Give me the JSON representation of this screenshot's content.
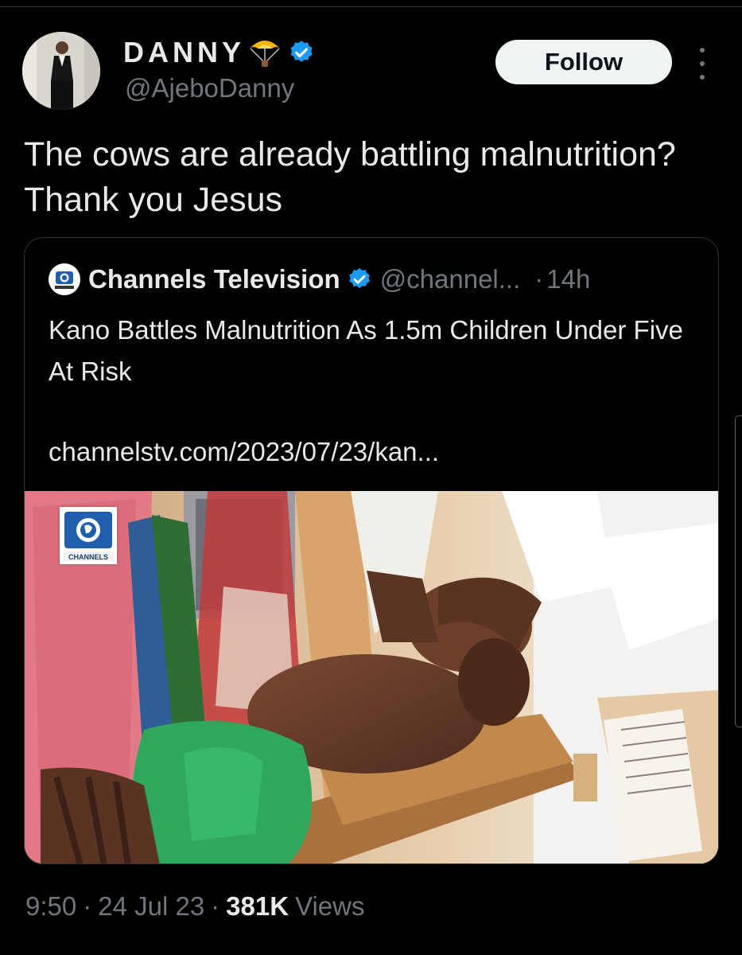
{
  "tweet": {
    "author_name": "DANNY",
    "author_handle": "@AjeboDanny",
    "follow_label": "Follow",
    "text": "The cows are already battling malnutrition? Thank you Jesus",
    "time": "9:50",
    "date": "24 Jul 23",
    "views_count": "381K",
    "views_label": "Views",
    "separator": "·"
  },
  "quote": {
    "author_name": "Channels Television",
    "author_handle": "@channel...",
    "separator": "·",
    "time": "14h",
    "text": "Kano Battles Malnutrition As 1.5m Children Under Five At Risk",
    "link": "channelstv.com/2023/07/23/kan...",
    "watermark_text": "CHANNELS"
  },
  "icons": {
    "author_emoji": "parachute-icon",
    "verified": "verified-badge-icon",
    "more": "more-options-icon"
  },
  "colors": {
    "background": "#000000",
    "text": "#e7e9ea",
    "secondary_text": "#71767b",
    "verified": "#1d9bf0",
    "follow_bg": "#eff3f4",
    "border": "#2f3336"
  }
}
